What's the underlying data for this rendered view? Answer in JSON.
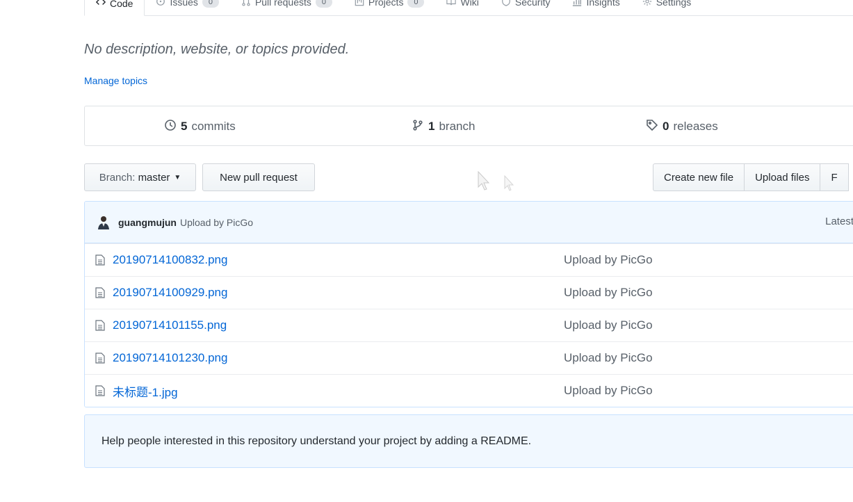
{
  "tabs": [
    {
      "label": "Code",
      "icon": "code-icon",
      "selected": true
    },
    {
      "label": "Issues",
      "count": "0",
      "icon": "issue-icon"
    },
    {
      "label": "Pull requests",
      "count": "0",
      "icon": "pull-request-icon"
    },
    {
      "label": "Projects",
      "count": "0",
      "icon": "project-icon"
    },
    {
      "label": "Wiki",
      "icon": "book-icon"
    },
    {
      "label": "Security",
      "icon": "shield-icon"
    },
    {
      "label": "Insights",
      "icon": "graph-icon"
    },
    {
      "label": "Settings",
      "icon": "gear-icon"
    }
  ],
  "repo": {
    "description": "No description, website, or topics provided.",
    "manage_topics": "Manage topics"
  },
  "summary": {
    "commits_count": "5",
    "commits_label": "commits",
    "branch_count": "1",
    "branch_label": "branch",
    "releases_count": "0",
    "releases_label": "releases"
  },
  "toolbar": {
    "branch_prefix": "Branch:",
    "branch_name": "master",
    "new_pull_request": "New pull request",
    "create_new_file": "Create new file",
    "upload_files": "Upload files",
    "find_file": "F"
  },
  "commit": {
    "author": "guangmujun",
    "message": "Upload by PicGo",
    "latest": "Latest"
  },
  "files": [
    {
      "name": "20190714100832.png",
      "message": "Upload by PicGo"
    },
    {
      "name": "20190714100929.png",
      "message": "Upload by PicGo"
    },
    {
      "name": "20190714101155.png",
      "message": "Upload by PicGo"
    },
    {
      "name": "20190714101230.png",
      "message": "Upload by PicGo"
    },
    {
      "name": "未标题-1.jpg",
      "message": "Upload by PicGo"
    }
  ],
  "readme_prompt": "Help people interested in this repository understand your project by adding a README.",
  "colors": {
    "link": "#0366d6",
    "muted": "#586069",
    "tease_bg": "#f1f8ff",
    "tease_border": "#c8e1ff",
    "tab_accent": "#e36209"
  }
}
